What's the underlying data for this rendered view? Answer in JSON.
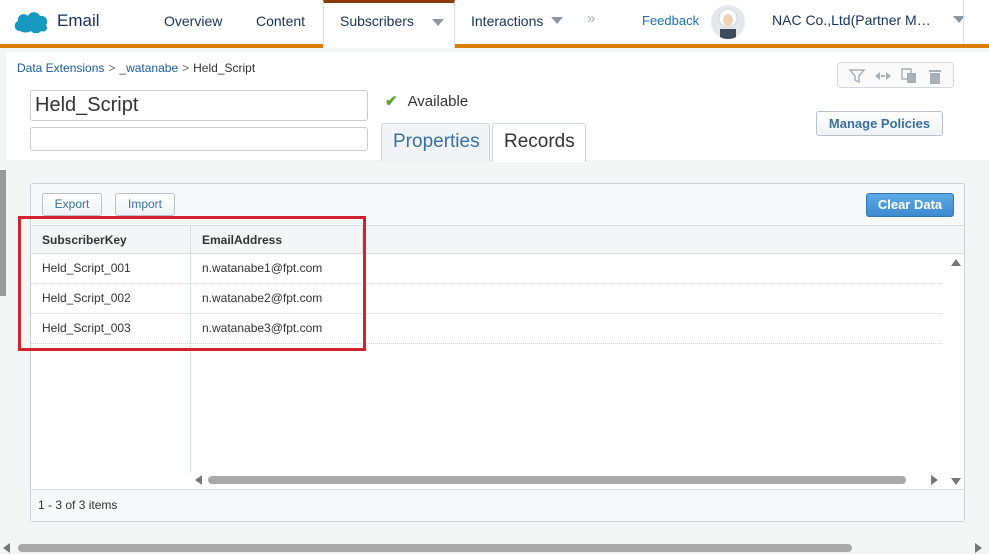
{
  "nav": {
    "app_name": "Email",
    "items": [
      {
        "label": "Overview"
      },
      {
        "label": "Content"
      },
      {
        "label": "Subscribers"
      },
      {
        "label": "Interactions"
      }
    ],
    "more_glyph": "»",
    "feedback": "Feedback",
    "account": "NAC Co.,Ltd(Partner M…",
    "brand_color": "#d97d08",
    "active_item": "Subscribers"
  },
  "breadcrumb": {
    "items": [
      "Data Extensions",
      "_watanabe"
    ],
    "current": "Held_Script",
    "separator": ">"
  },
  "extension": {
    "name": "Held_Script",
    "description": "",
    "status": "Available"
  },
  "tabs": [
    {
      "label": "Properties"
    },
    {
      "label": "Records"
    }
  ],
  "active_tab": "Records",
  "toolbar_icons": [
    "filter-icon",
    "compare-icon",
    "copy-icon",
    "trash-icon"
  ],
  "buttons": {
    "manage_policies": "Manage Policies",
    "export": "Export",
    "import": "Import",
    "clear_data": "Clear Data"
  },
  "grid": {
    "columns": [
      "SubscriberKey",
      "EmailAddress"
    ],
    "rows": [
      [
        "Held_Script_001",
        "n.watanabe1@fpt.com"
      ],
      [
        "Held_Script_002",
        "n.watanabe2@fpt.com"
      ],
      [
        "Held_Script_003",
        "n.watanabe3@fpt.com"
      ]
    ],
    "footer": "1 - 3 of 3 items"
  },
  "colors": {
    "highlight": "#d3222f",
    "primary_button": "#3b8ad0",
    "link": "#1a5c9a",
    "status_check": "#5aa32e"
  }
}
